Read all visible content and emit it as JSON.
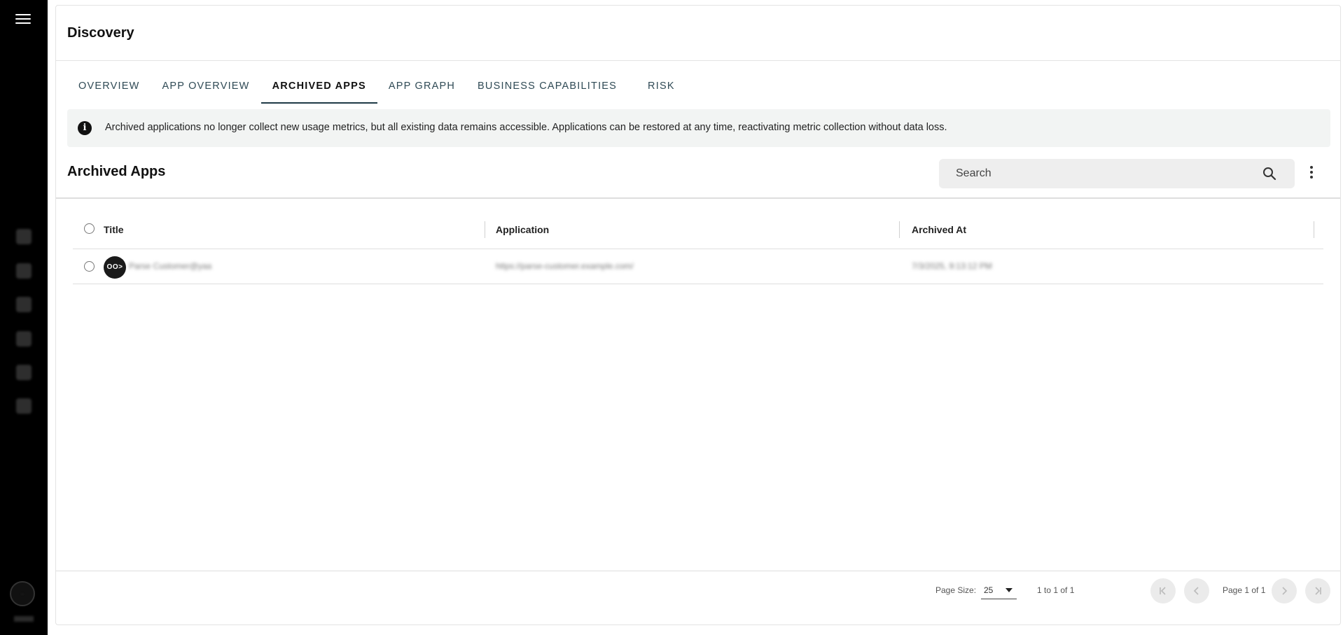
{
  "nav": {
    "menu_icon": "hamburger-icon",
    "items": [
      "dashboard-icon",
      "search-icon",
      "settings-icon",
      "inbox-icon",
      "star-icon",
      "help-icon"
    ]
  },
  "page": {
    "title": "Discovery"
  },
  "tabs": [
    {
      "label": "OVERVIEW",
      "active": false
    },
    {
      "label": "APP OVERVIEW",
      "active": false
    },
    {
      "label": "ARCHIVED APPS",
      "active": true
    },
    {
      "label": "APP GRAPH",
      "active": false
    },
    {
      "label": "BUSINESS CAPABILITIES",
      "active": false
    },
    {
      "label": "RISK",
      "active": false
    }
  ],
  "banner": {
    "icon": "info-icon",
    "text": "Archived applications no longer collect new usage metrics, but all existing data remains accessible. Applications can be restored at any time, reactivating metric collection without data loss."
  },
  "section": {
    "title": "Archived Apps",
    "search_placeholder": "Search"
  },
  "table": {
    "columns": [
      "Title",
      "Application",
      "Archived At"
    ],
    "rows": [
      {
        "avatar": "OO>",
        "title": "Parse Customer@yaa",
        "application": "https://parse-customer.example.com/",
        "archived_at": "7/3/2025, 9:13:12 PM"
      }
    ]
  },
  "pagination": {
    "page_size_label": "Page Size:",
    "page_size": "25",
    "range": "1 to 1 of 1",
    "page": "Page 1 of 1"
  },
  "colors": {
    "sidebar": "#000000",
    "active_tab": "#1f3a46",
    "banner_bg": "#f2f4f3"
  }
}
